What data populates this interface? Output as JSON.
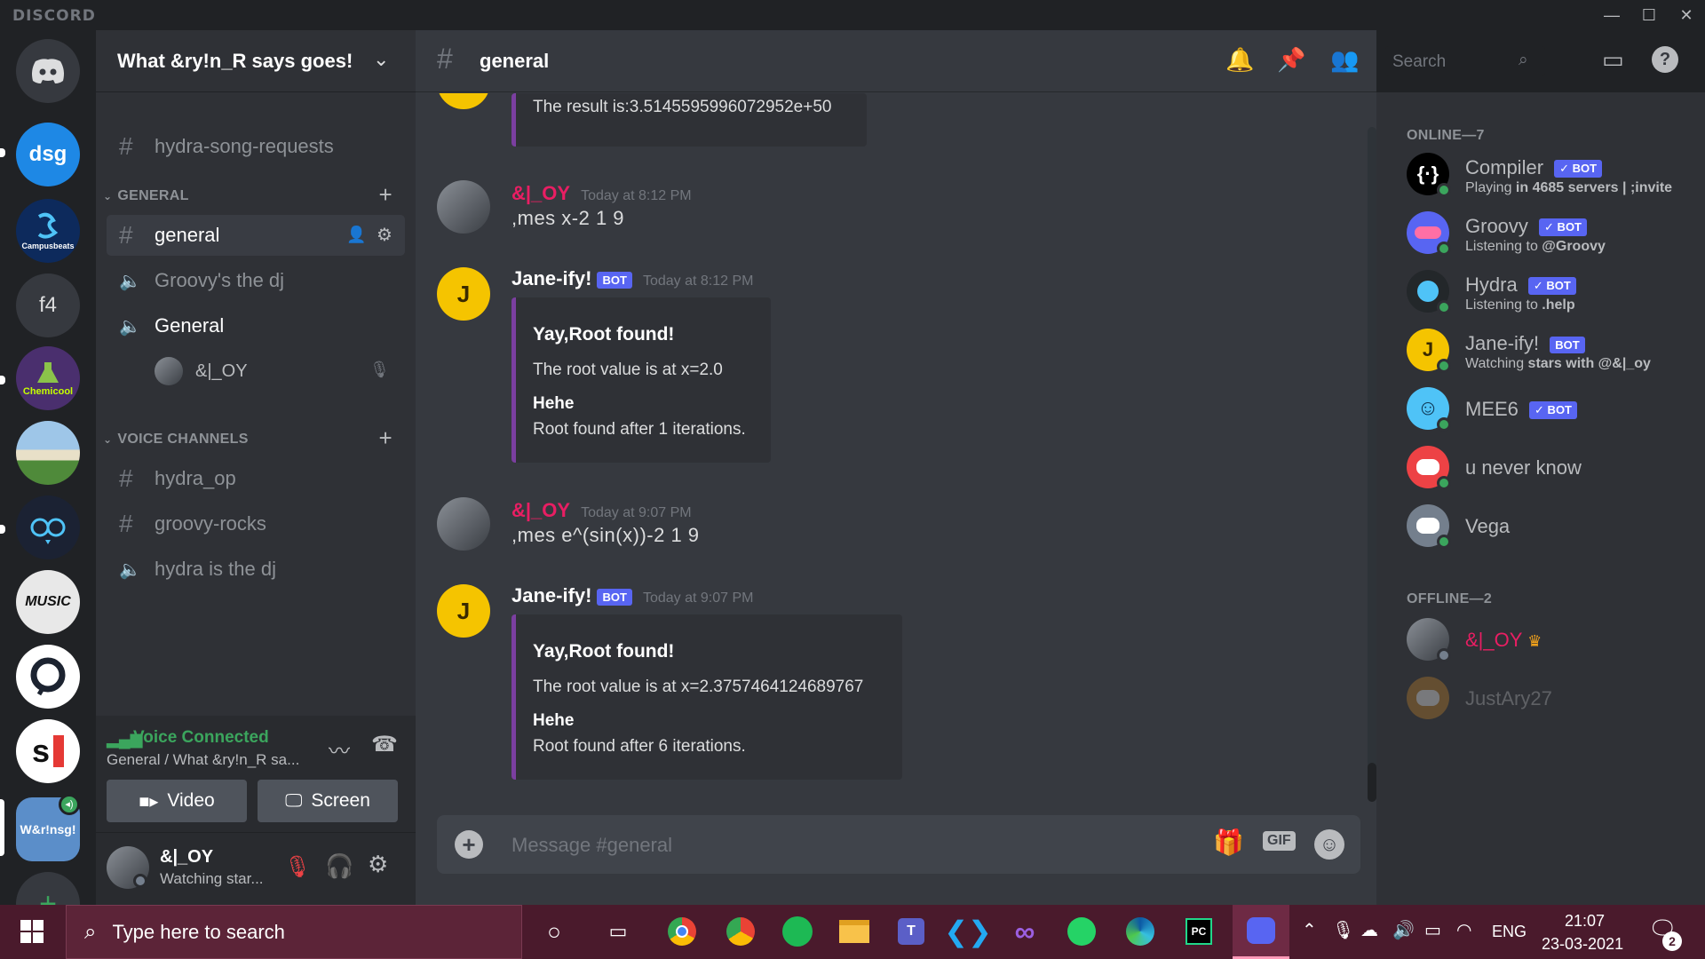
{
  "window": {
    "brand": "DISCORD",
    "min": "—",
    "max": "☐",
    "close": "✕"
  },
  "servers": [
    {
      "label": "",
      "icon": "discord-home-icon"
    },
    {
      "label": "dsg"
    },
    {
      "label": "Campusbeats"
    },
    {
      "label": "f4"
    },
    {
      "label": "Chemicool"
    },
    {
      "label": ""
    },
    {
      "label": ""
    },
    {
      "label": "MUSIC"
    },
    {
      "label": ""
    },
    {
      "label": "s"
    },
    {
      "label": "W&r!nsg!"
    }
  ],
  "guild": {
    "name": "What &ry!n_R says goes!"
  },
  "channels": {
    "top": {
      "name": "hydra-song-requests"
    },
    "general_category": "GENERAL",
    "general": "general",
    "groovy": "Groovy's the dj",
    "general_voice": "General",
    "voice_user": "&|_OY",
    "voice_category": "VOICE CHANNELS",
    "hydra_op": "hydra_op",
    "groovy_rocks": "groovy-rocks",
    "hydra_dj": "hydra is the dj"
  },
  "voice": {
    "status": "Voice Connected",
    "location": "General / What &ry!n_R sa...",
    "video": "Video",
    "screen": "Screen"
  },
  "user": {
    "name": "&|_OY",
    "status": "Watching star..."
  },
  "chat": {
    "channel": "general",
    "search_placeholder": "Search",
    "composer_placeholder": "Message #general",
    "gif": "GIF",
    "messages": [
      {
        "content": "The result is:3.5145595996072952e+50"
      },
      {
        "author": "&|_OY",
        "time": "Today at 8:12 PM",
        "content": ",mes x-2 1 9"
      },
      {
        "author": "Jane-ify!",
        "bot": "BOT",
        "time": "Today at 8:12 PM",
        "embed": {
          "title": "Yay,Root found!",
          "desc": "The root value is at x=2.0",
          "field_name": "Hehe",
          "field_value": "Root found after 1 iterations."
        }
      },
      {
        "author": "&|_OY",
        "time": "Today at 9:07 PM",
        "content": ",mes e^(sin(x))-2 1 9"
      },
      {
        "author": "Jane-ify!",
        "bot": "BOT",
        "time": "Today at 9:07 PM",
        "embed": {
          "title": "Yay,Root found!",
          "desc": "The root value is at x=2.3757464124689767",
          "field_name": "Hehe",
          "field_value": "Root found after 6 iterations."
        }
      }
    ]
  },
  "members": {
    "online_header": "ONLINE—7",
    "offline_header": "OFFLINE—2",
    "online": [
      {
        "name": "Compiler",
        "bot": "✓ BOT",
        "status_pre": "Playing ",
        "status_bold": "in 4685 servers | ;invite",
        "color": "#000000"
      },
      {
        "name": "Groovy",
        "bot": "✓ BOT",
        "status_pre": "Listening to ",
        "status_bold": "@Groovy",
        "color": "#5865f2"
      },
      {
        "name": "Hydra",
        "bot": "✓ BOT",
        "status_pre": "Listening to ",
        "status_bold": ".help",
        "color": "#23272a"
      },
      {
        "name": "Jane-ify!",
        "bot": "BOT",
        "status_pre": "Watching ",
        "status_bold": "stars with @&|_oy",
        "color": "#f5c400"
      },
      {
        "name": "MEE6",
        "bot": "✓ BOT",
        "status_pre": "",
        "status_bold": "",
        "color": "#4fc3f7"
      },
      {
        "name": "u never know",
        "bot": "",
        "status_pre": "",
        "status_bold": "",
        "color": "#ed4245"
      },
      {
        "name": "Vega",
        "bot": "",
        "status_pre": "",
        "status_bold": "",
        "color": "#747f8d"
      }
    ],
    "offline": [
      {
        "name": "&|_OY",
        "crown": "♛"
      },
      {
        "name": "JustAry27"
      }
    ]
  },
  "taskbar": {
    "search_placeholder": "Type here to search",
    "lang": "ENG",
    "time": "21:07",
    "date": "23-03-2021",
    "notif_count": "2"
  }
}
